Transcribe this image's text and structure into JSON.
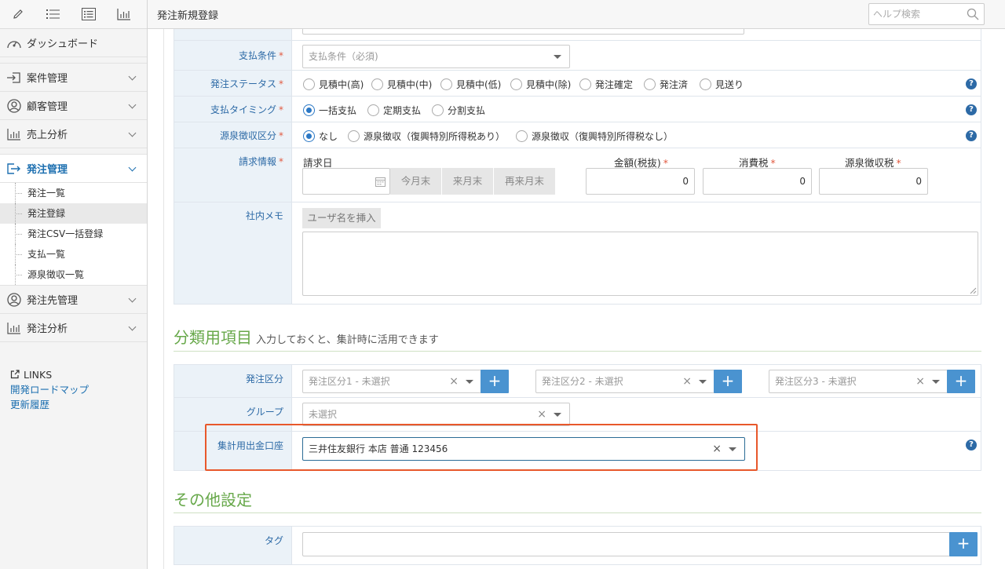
{
  "sidebar": {
    "toolbar": [
      "pencil-icon",
      "list-icon",
      "list-box-icon",
      "chart-icon"
    ],
    "nav": [
      {
        "label": "ダッシュボード",
        "icon": "dashboard-icon"
      },
      {
        "label": "案件管理",
        "icon": "login-icon"
      },
      {
        "label": "顧客管理",
        "icon": "user-circle-icon"
      },
      {
        "label": "売上分析",
        "icon": "bar-chart-icon"
      },
      {
        "label": "発注管理",
        "icon": "export-icon"
      },
      {
        "label": "発注先管理",
        "icon": "user-circle-icon"
      },
      {
        "label": "発注分析",
        "icon": "bar-chart-icon"
      }
    ],
    "sub_items": [
      "発注一覧",
      "発注登録",
      "発注CSV一括登録",
      "支払一覧",
      "源泉徴収一覧"
    ],
    "links_title": "LINKS",
    "links": [
      "開発ロードマップ",
      "更新履歴"
    ]
  },
  "header": {
    "title": "発注新規登録",
    "search_placeholder": "ヘルプ検索"
  },
  "form": {
    "payment_terms": {
      "label": "支払条件",
      "placeholder": "支払条件（必須)"
    },
    "order_status": {
      "label": "発注ステータス",
      "options": [
        "見積中(高)",
        "見積中(中)",
        "見積中(低)",
        "見積中(除)",
        "発注確定",
        "発注済",
        "見送り"
      ]
    },
    "payment_timing": {
      "label": "支払タイミング",
      "options": [
        "一括支払",
        "定期支払",
        "分割支払"
      ],
      "selected": "一括支払"
    },
    "withholding": {
      "label": "源泉徴収区分",
      "options": [
        "なし",
        "源泉徴収（復興特別所得税あり）",
        "源泉徴収（復興特別所得税なし）"
      ],
      "selected": "なし"
    },
    "billing": {
      "label": "請求情報",
      "date_label": "請求日",
      "buttons": [
        "今月末",
        "来月末",
        "再来月末"
      ],
      "amount_label": "金額(税抜)",
      "tax_label": "消費税",
      "withholding_label": "源泉徴収税",
      "amount": "0",
      "tax": "0",
      "withholding": "0"
    },
    "memo": {
      "label": "社内メモ",
      "insert_button": "ユーザ名を挿入"
    }
  },
  "classification": {
    "title": "分類用項目",
    "subtitle": "入力しておくと、集計時に活用できます",
    "order_category": {
      "label": "発注区分",
      "selects": [
        "発注区分1 - 未選択",
        "発注区分2 - 未選択",
        "発注区分3 - 未選択"
      ],
      "add": "+"
    },
    "group": {
      "label": "グループ",
      "placeholder": "未選択"
    },
    "bank_account": {
      "label": "集計用出金口座",
      "value": "三井住友銀行 本店 普通 123456"
    }
  },
  "other": {
    "title": "その他設定",
    "tag": {
      "label": "タグ",
      "add": "+"
    }
  },
  "glyphs": {
    "required": "*",
    "help": "?",
    "clear": "×",
    "calendar": "📅"
  },
  "colors": {
    "accent": "#2d6aa6",
    "section": "#67a84a",
    "highlight": "#e8582b",
    "plus": "#4a93d0"
  }
}
